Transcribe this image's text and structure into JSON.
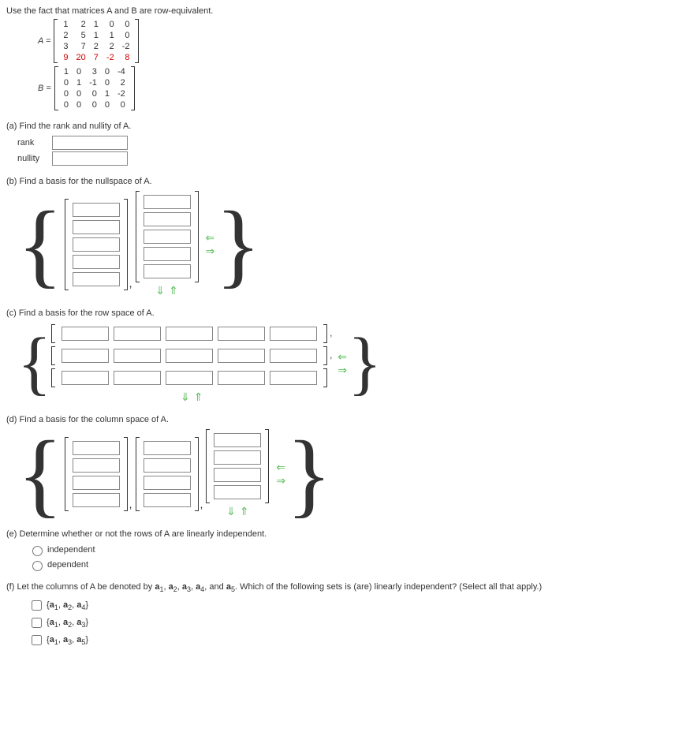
{
  "intro": "Use the fact that matrices A and B are row-equivalent.",
  "matA_label": "A =",
  "matB_label": "B =",
  "A": [
    [
      "1",
      "2",
      "1",
      "0",
      "0"
    ],
    [
      "2",
      "5",
      "1",
      "1",
      "0"
    ],
    [
      "3",
      "7",
      "2",
      "2",
      "-2"
    ],
    [
      "9",
      "20",
      "7",
      "-2",
      "8"
    ]
  ],
  "B": [
    [
      "1",
      "0",
      "3",
      "0",
      "-4"
    ],
    [
      "0",
      "1",
      "-1",
      "0",
      "2"
    ],
    [
      "0",
      "0",
      "0",
      "1",
      "-2"
    ],
    [
      "0",
      "0",
      "0",
      "0",
      "0"
    ]
  ],
  "a": {
    "q": "(a) Find the rank and nullity of A.",
    "rank_label": "rank",
    "nullity_label": "nullity"
  },
  "b": {
    "q": "(b) Find a basis for the nullspace of A."
  },
  "c": {
    "q": "(c) Find a basis for the row space of A."
  },
  "d": {
    "q": "(d) Find a basis for the column space of A."
  },
  "e": {
    "q": "(e) Determine whether or not the rows of A are linearly independent.",
    "opt1": "independent",
    "opt2": "dependent"
  },
  "f": {
    "q_pre": "(f) Let the columns of A be denoted by ",
    "q_post": ". Which of the following sets is (are) linearly independent? (Select all that apply.)",
    "opt1_html": "{a1, a2, a4}",
    "opt2_html": "{a1, a2, a3}",
    "opt3_html": "{a1, a3, a5}"
  },
  "glyph": {
    "left_arrow": "⇐",
    "right_arrow": "⇒",
    "down_arrow": "⇓",
    "up_arrow": "⇑"
  }
}
